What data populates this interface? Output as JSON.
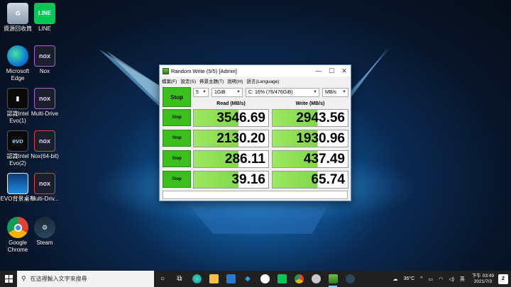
{
  "desktop_icons": [
    {
      "name": "recycle-bin-icon",
      "label": "資源回收筒"
    },
    {
      "name": "line-icon",
      "label": "LINE",
      "glyph": "LINE"
    },
    {
      "name": "edge-icon",
      "label": "Microsoft Edge"
    },
    {
      "name": "nox-icon",
      "label": "Nox",
      "glyph": "nox"
    },
    {
      "name": "intel-evo-icon",
      "label": "認識Intel Evo(1)"
    },
    {
      "name": "multi-drive-icon",
      "label": "Multi-Drive",
      "glyph": "nox"
    },
    {
      "name": "intel-evo2-icon",
      "label": "認識Intel Evo(2)",
      "glyph": "evo"
    },
    {
      "name": "nox64-icon",
      "label": "Nox(64-bit)",
      "glyph": "nox"
    },
    {
      "name": "evo-wallpaper-icon",
      "label": "EVO背景桌布"
    },
    {
      "name": "multi-drive2-icon",
      "label": "Multi-Driv...",
      "glyph": "nox"
    },
    {
      "name": "chrome-icon",
      "label": "Google Chrome"
    },
    {
      "name": "steam-icon",
      "label": "Steam"
    }
  ],
  "window": {
    "title": "Random Write (5/5) [Admin]",
    "controls": {
      "minimize": "—",
      "maximize": "☐",
      "close": "✕"
    },
    "menu": [
      "檔案(F)",
      "設定(S)",
      "佈景主題(T)",
      "說明(H)",
      "語言(Language)"
    ],
    "main_button": "Stop",
    "count": "5",
    "size": "1GiB",
    "drive": "C: 16% (76/476GiB)",
    "unit": "MB/s",
    "read_header": "Read (MB/s)",
    "write_header": "Write (MB/s)",
    "rows": [
      {
        "button": "Stop",
        "read": "3546.69",
        "write": "2943.56"
      },
      {
        "button": "Stop",
        "read": "2130.20",
        "write": "1930.96"
      },
      {
        "button": "Stop",
        "read": "286.11",
        "write": "437.49"
      },
      {
        "button": "Stop",
        "read": "39.16",
        "write": "65.74"
      }
    ]
  },
  "taskbar": {
    "search_placeholder": "在這裡輸入文字來搜尋",
    "weather": "36°C",
    "ime": "英",
    "time": "下午 03:49",
    "date": "2021/7/3",
    "notifications": "2"
  }
}
